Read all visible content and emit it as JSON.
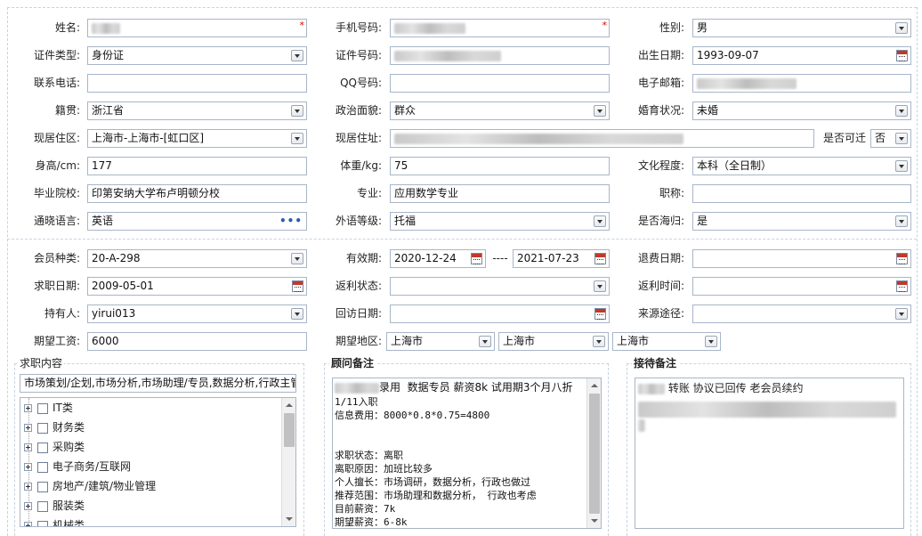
{
  "row1": {
    "name_label": "姓名:",
    "phone_label": "手机号码:",
    "gender_label": "性别:",
    "gender_value": "男",
    "required_mark": "*"
  },
  "row2": {
    "idtype_label": "证件类型:",
    "idtype_value": "身份证",
    "idnum_label": "证件号码:",
    "birth_label": "出生日期:",
    "birth_value": "1993-09-07"
  },
  "row3": {
    "tel_label": "联系电话:",
    "qq_label": "QQ号码:",
    "email_label": "电子邮箱:"
  },
  "row4": {
    "native_label": "籍贯:",
    "native_value": "浙江省",
    "politic_label": "政治面貌:",
    "politic_value": "群众",
    "marital_label": "婚育状况:",
    "marital_value": "未婚"
  },
  "row5": {
    "residence_label": "现居住区:",
    "residence_value": "上海市-上海市-[虹口区]",
    "address_label": "现居住址:",
    "relocate_label": "是否可迁",
    "relocate_value": "否"
  },
  "row6": {
    "height_label": "身高/cm:",
    "height_value": "177",
    "weight_label": "体重/kg:",
    "weight_value": "75",
    "edu_label": "文化程度:",
    "edu_value": "本科（全日制）"
  },
  "row7": {
    "school_label": "毕业院校:",
    "school_value": "印第安纳大学布卢明顿分校",
    "major_label": "专业:",
    "major_value": "应用数学专业",
    "title_label": "职称:"
  },
  "row8": {
    "lang_label": "通晓语言:",
    "lang_value": "英语",
    "lang_more": "•••",
    "foreign_label": "外语等级:",
    "foreign_value": "托福",
    "overseas_label": "是否海归:",
    "overseas_value": "是"
  },
  "row9": {
    "member_label": "会员种类:",
    "member_value": "20-A-298",
    "valid_label": "有效期:",
    "valid_from": "2020-12-24",
    "valid_sep": "----",
    "valid_to": "2021-07-23",
    "refund_label": "退费日期:"
  },
  "row10": {
    "jobdate_label": "求职日期:",
    "jobdate_value": "2009-05-01",
    "rebate_label": "返利状态:",
    "rebatetime_label": "返利时间:"
  },
  "row11": {
    "holder_label": "持有人:",
    "holder_value": "yirui013",
    "visit_label": "回访日期:",
    "source_label": "来源途径:"
  },
  "row12": {
    "salary_label": "期望工资:",
    "salary_value": "6000",
    "area_label": "期望地区:",
    "area1": "上海市",
    "area2": "上海市",
    "area3": "上海市"
  },
  "job_content": {
    "title": "求职内容",
    "summary": "市场策划/企划,市场分析,市场助理/专员,数据分析,行政主管",
    "categories": [
      "IT类",
      "财务类",
      "采购类",
      "电子商务/互联网",
      "房地产/建筑/物业管理",
      "服装类",
      "机械类"
    ]
  },
  "advisor_note": {
    "title": "顾问备注",
    "text_after_name": "录用  数据专员 薪资8k 试用期3个月八折",
    "lines": [
      "1/11入职",
      "信息费用：8000*0.8*0.75=4800",
      "",
      "",
      "求职状态：离职",
      "离职原因：加班比较多",
      "个人擅长：市场调研，数据分析，行政也做过",
      "推荐范围：市场助理和数据分析， 行政也考虑",
      "目前薪资：7k",
      "期望薪资：6-8k"
    ]
  },
  "reception_note": {
    "title": "接待备注",
    "text_after_name": "转账 协议已回传 老会员续约"
  }
}
